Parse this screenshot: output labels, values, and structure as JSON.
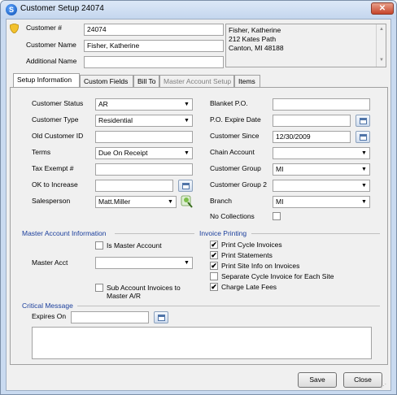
{
  "window": {
    "title": "Customer Setup 24074",
    "app_icon_glyph": "S",
    "close_glyph": "✕"
  },
  "header": {
    "customer_no_label": "Customer #",
    "customer_no_value": "24074",
    "customer_name_label": "Customer Name",
    "customer_name_value": "Fisher, Katherine",
    "additional_name_label": "Additional Name",
    "additional_name_value": "",
    "address_lines": [
      "Fisher, Katherine",
      "212  Kates Path",
      "Canton, MI  48188"
    ]
  },
  "tabs": [
    {
      "label": "Setup Information",
      "active": true
    },
    {
      "label": "Custom Fields"
    },
    {
      "label": "Bill To"
    },
    {
      "label": "Master Account Setup",
      "disabled": true
    },
    {
      "label": "Items"
    }
  ],
  "setup": {
    "customer_status_label": "Customer Status",
    "customer_status_value": "AR",
    "customer_type_label": "Customer Type",
    "customer_type_value": "Residential",
    "old_customer_id_label": "Old Customer ID",
    "old_customer_id_value": "",
    "terms_label": "Terms",
    "terms_value": "Due On Receipt",
    "tax_exempt_label": "Tax Exempt #",
    "tax_exempt_value": "",
    "ok_to_increase_label": "OK to Increase",
    "ok_to_increase_value": "",
    "salesperson_label": "Salesperson",
    "salesperson_value": "Matt.Miller",
    "blanket_po_label": "Blanket P.O.",
    "blanket_po_value": "",
    "po_expire_label": "P.O. Expire Date",
    "po_expire_value": "",
    "customer_since_label": "Customer Since",
    "customer_since_value": "12/30/2009",
    "chain_account_label": "Chain Account",
    "chain_account_value": "",
    "customer_group_label": "Customer Group",
    "customer_group_value": "MI",
    "customer_group2_label": "Customer Group 2",
    "customer_group2_value": "",
    "branch_label": "Branch",
    "branch_value": "MI",
    "no_collections_label": "No Collections"
  },
  "master_account": {
    "heading": "Master Account Information",
    "is_master_label": "Is Master Account",
    "master_acct_label": "Master Acct",
    "master_acct_value": "",
    "sub_invoices_label_line1": "Sub Account Invoices to",
    "sub_invoices_label_line2": "Master A/R"
  },
  "invoice_printing": {
    "heading": "Invoice Printing",
    "options": [
      {
        "label": "Print Cycle Invoices",
        "checked": true
      },
      {
        "label": "Print Statements",
        "checked": true
      },
      {
        "label": "Print Site Info on Invoices",
        "checked": true
      },
      {
        "label": "Separate Cycle Invoice for Each Site",
        "checked": false
      },
      {
        "label": "Charge Late Fees",
        "checked": true
      }
    ]
  },
  "critical_message": {
    "heading": "Critical Message",
    "expires_on_label": "Expires On",
    "expires_on_value": "",
    "message": ""
  },
  "buttons": {
    "save": "Save",
    "close": "Close"
  },
  "check_glyph": "✔",
  "dropdown_arrow_glyph": "▼"
}
